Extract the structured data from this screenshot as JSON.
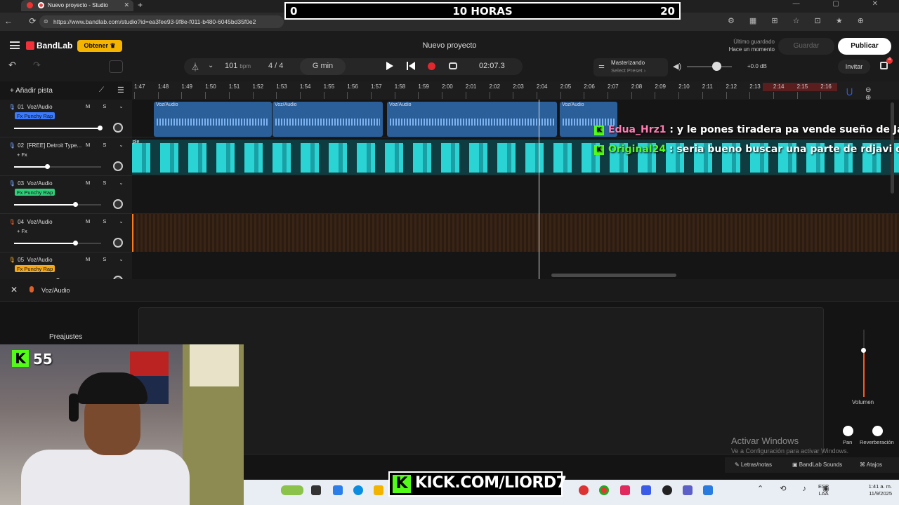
{
  "browser": {
    "tab_title": "Nuevo proyecto - Studio",
    "tab_close": "✕",
    "new_tab": "+",
    "window_controls": "— ▢ ✕",
    "nav": "← ⟳",
    "url": "https://www.bandlab.com/studio?id=ea3fee93-9f8e-f011-b480-6045bd35f0e2",
    "toolbar_icons": "⚙ ▦ ⊞ ☆ ⊡ ★ ⊕"
  },
  "timer": {
    "left": "0",
    "center": "10 HORAS",
    "right": "20"
  },
  "app": {
    "brand": "BandLab",
    "obtener_label": "Obtener ♛",
    "project_title": "Nuevo proyecto",
    "saved_label": "Último guardado",
    "saved_value": "Hace un momento",
    "guardar_label": "Guardar",
    "publicar_label": "Publicar"
  },
  "transport": {
    "undo": "↶",
    "redo": "↷",
    "metronome_icon": "⏃",
    "bpm_value": "101",
    "bpm_unit": "bpm",
    "time_signature": "4 / 4",
    "key": "G min",
    "timecode": "02:07.3",
    "mastering_title": "Masterizando",
    "mastering_preset": "Select Preset ›",
    "volume_db": "+0.0 dB",
    "invitar_label": "Invitar",
    "gift_badge": "4"
  },
  "ruler": {
    "add_track": "+  Añadir pista",
    "labels": [
      "1:47",
      "1:48",
      "1:49",
      "1:50",
      "1:51",
      "1:52",
      "1:53",
      "1:54",
      "1:55",
      "1:56",
      "1:57",
      "1:58",
      "1:59",
      "2:00",
      "2:01",
      "2:02",
      "2:03",
      "2:04",
      "2:05",
      "2:06",
      "2:07",
      "2:08",
      "2:09",
      "2:10",
      "2:11",
      "2:12",
      "2:13",
      "2:14",
      "2:15",
      "2:16"
    ],
    "magnet_icon": "⋃",
    "zoom_icons": "⊖ ⊕"
  },
  "tracks": [
    {
      "num": "01",
      "name": "Voz/Audio",
      "fx": "Fx Punchy Rap",
      "fx_color": "#3a7bff",
      "volume": 0.98,
      "ms": "M S ⌄"
    },
    {
      "num": "02",
      "name": "[FREE] Detroit Type...",
      "fx": "+ Fx",
      "fx_color": "",
      "volume": 0.38,
      "ms": "M S ⌄"
    },
    {
      "num": "03",
      "name": "Voz/Audio",
      "fx": "Fx Punchy Rap",
      "fx_color": "#2fd07a",
      "volume": 0.7,
      "ms": "M S ⌄"
    },
    {
      "num": "04",
      "name": "Voz/Audio",
      "fx": "+ Fx",
      "fx_color": "",
      "volume": 0.7,
      "ms": "M S ⌄"
    },
    {
      "num": "05",
      "name": "Voz/Audio",
      "fx": "Fx Punchy Rap",
      "fx_color": "#f5a81a",
      "volume": 0.5,
      "ms": "M S ⌄"
    }
  ],
  "clips": {
    "track1": [
      "Voz/Audio",
      "Voz/Audio",
      "Voz/Audio",
      "Voz/Audio"
    ],
    "track2_label": "ple"
  },
  "chat": [
    {
      "user": "Edua_Hrz1",
      "message": " : y le pones tiradera pa vende sueño de Javi jsjs"
    },
    {
      "user": "Original24",
      "message": " : seria bueno buscar una parte de rdjavi diciend"
    }
  ],
  "editor": {
    "close": "✕",
    "title": "Voz/Audio",
    "preajustes": "Preajustes",
    "volumen_label": "Volumen",
    "pan_label": "Pan",
    "reverb_label": "Reverberación",
    "volume_level": 0.7
  },
  "windows_watermark": {
    "line1": "Activar Windows",
    "line2": "Ve a Configuración para activar Windows."
  },
  "bottom_bar": {
    "letras": "✎  Letras/notas",
    "sounds": "▣ BandLab Sounds",
    "atajos": "⌘  Atajos"
  },
  "stream": {
    "viewer_count": "55",
    "kick_handle": "KICK.COM/LIORD7",
    "kick_k": "K"
  },
  "taskbar": {
    "lang1": "ESP",
    "lang2": "LAA",
    "time": "1:41 a. m.",
    "date": "11/9/2025",
    "sys_icons": "⌃ ⟲ ♪ ◉"
  }
}
